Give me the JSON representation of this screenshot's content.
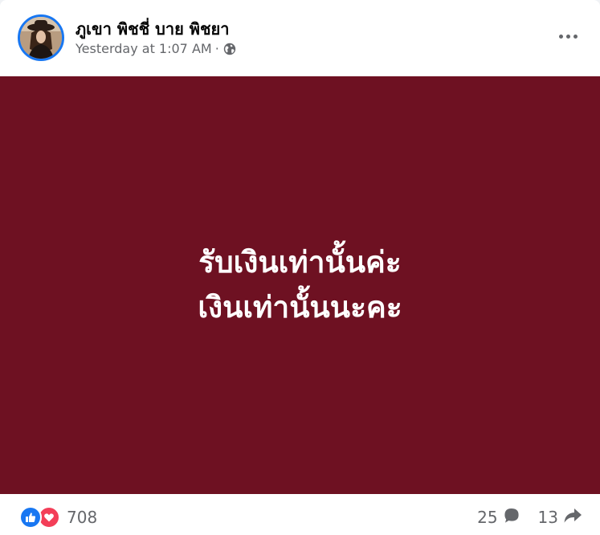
{
  "post": {
    "author": "ภูเขา พิชชี่ บาย พิชยา",
    "timestamp": "Yesterday at 1:07 AM",
    "separator": "·",
    "audience_icon": "globe-icon",
    "more_icon": "more-options-icon",
    "media": {
      "background_color": "#6e1122",
      "text_color": "#ffffff",
      "lines": [
        "รับเงินเท่านั้นค่ะ",
        "เงินเท่านั้นนะคะ"
      ]
    }
  },
  "footer": {
    "reactions": {
      "icons": [
        "like-icon",
        "love-icon"
      ],
      "count": "708"
    },
    "comments": {
      "count": "25",
      "icon": "comment-icon"
    },
    "shares": {
      "count": "13",
      "icon": "share-icon"
    }
  },
  "colors": {
    "accent": "#1877f2",
    "like": "#1877f2",
    "love": "#f33e58",
    "secondary_text": "#65676b"
  }
}
